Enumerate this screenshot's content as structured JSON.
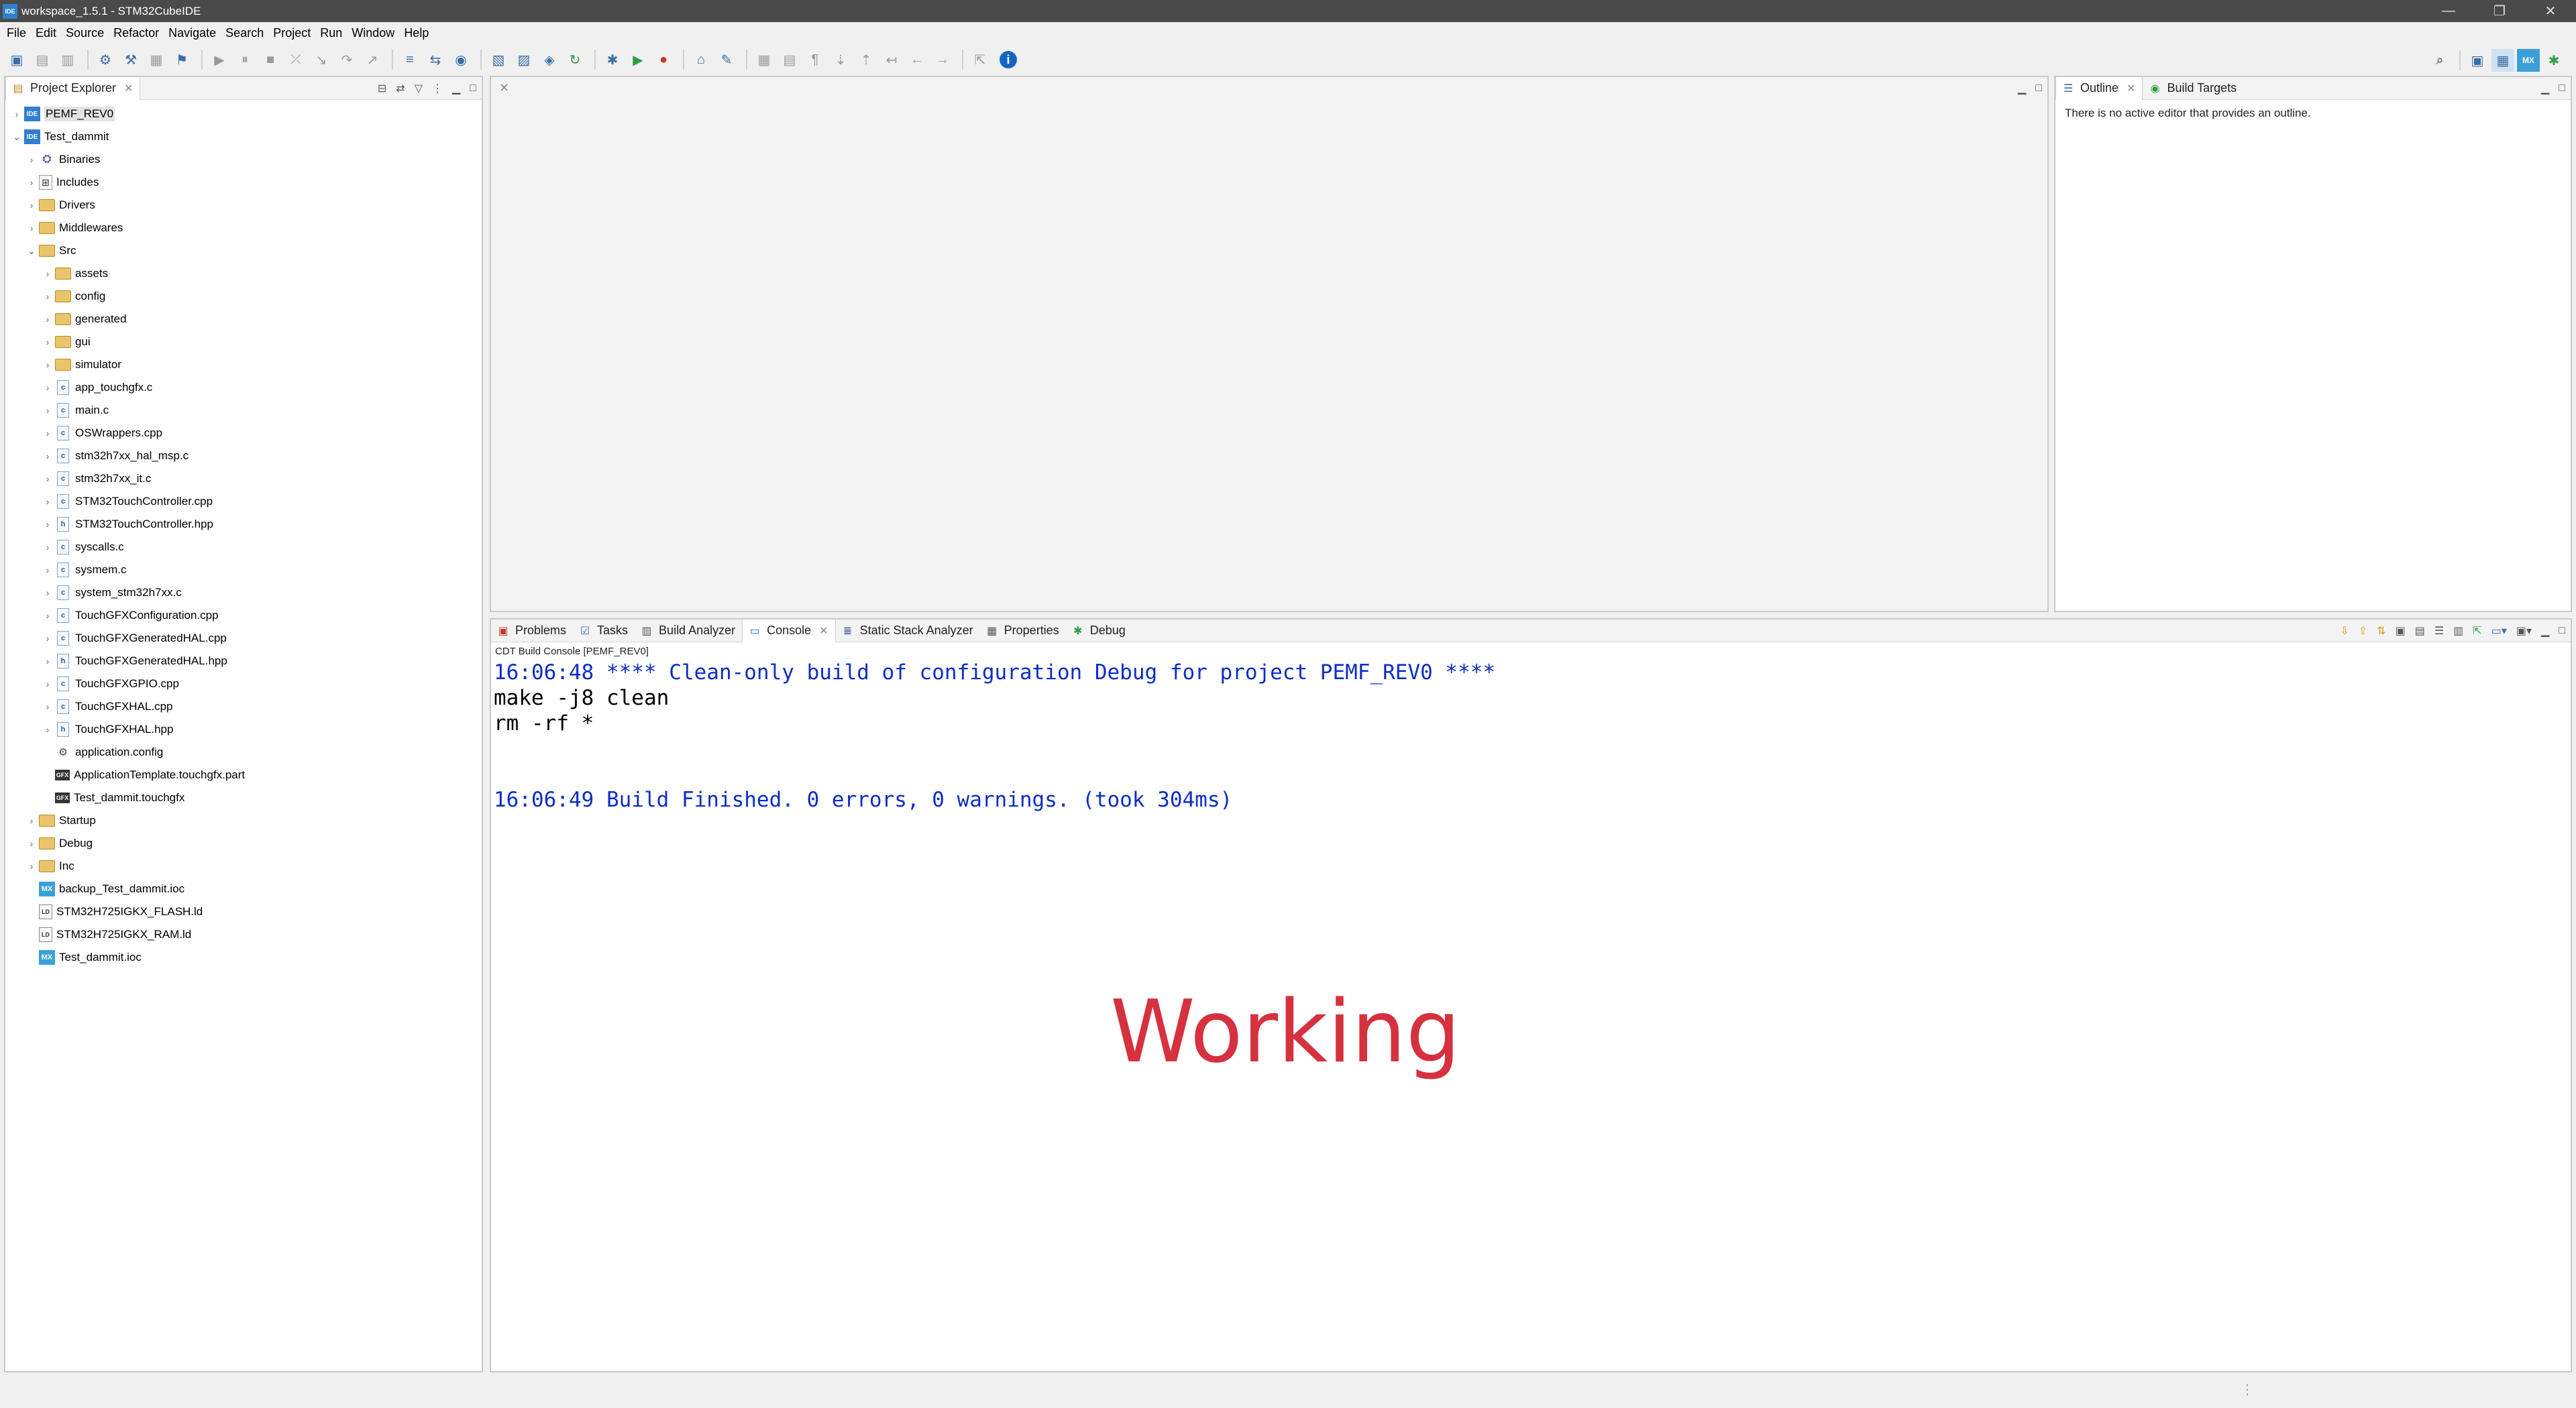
{
  "window": {
    "title": "workspace_1.5.1 - STM32CubeIDE",
    "app_icon": "IDE",
    "controls": [
      "—",
      "❐",
      "✕"
    ]
  },
  "menubar": [
    "File",
    "Edit",
    "Source",
    "Refactor",
    "Navigate",
    "Search",
    "Project",
    "Run",
    "Window",
    "Help"
  ],
  "project_explorer": {
    "tab_label": "Project Explorer",
    "tree": [
      {
        "label": "PEMF_REV0",
        "icon": "project",
        "expand": "collapsed",
        "indent": 0,
        "selected": true
      },
      {
        "label": "Test_dammit",
        "icon": "project",
        "expand": "expanded",
        "indent": 0
      },
      {
        "label": "Binaries",
        "icon": "binaries",
        "expand": "collapsed",
        "indent": 1
      },
      {
        "label": "Includes",
        "icon": "includes",
        "expand": "collapsed",
        "indent": 1
      },
      {
        "label": "Drivers",
        "icon": "folder",
        "expand": "collapsed",
        "indent": 1
      },
      {
        "label": "Middlewares",
        "icon": "folder",
        "expand": "collapsed",
        "indent": 1
      },
      {
        "label": "Src",
        "icon": "folder",
        "expand": "expanded",
        "indent": 1
      },
      {
        "label": "assets",
        "icon": "folder",
        "expand": "collapsed",
        "indent": 2
      },
      {
        "label": "config",
        "icon": "folder",
        "expand": "collapsed",
        "indent": 2
      },
      {
        "label": "generated",
        "icon": "folder",
        "expand": "collapsed",
        "indent": 2
      },
      {
        "label": "gui",
        "icon": "folder",
        "expand": "collapsed",
        "indent": 2
      },
      {
        "label": "simulator",
        "icon": "folder",
        "expand": "collapsed",
        "indent": 2
      },
      {
        "label": "app_touchgfx.c",
        "icon": "c-file",
        "expand": "collapsed",
        "indent": 2
      },
      {
        "label": "main.c",
        "icon": "c-file",
        "expand": "collapsed",
        "indent": 2
      },
      {
        "label": "OSWrappers.cpp",
        "icon": "c-file",
        "expand": "collapsed",
        "indent": 2
      },
      {
        "label": "stm32h7xx_hal_msp.c",
        "icon": "c-file",
        "expand": "collapsed",
        "indent": 2
      },
      {
        "label": "stm32h7xx_it.c",
        "icon": "c-file",
        "expand": "collapsed",
        "indent": 2
      },
      {
        "label": "STM32TouchController.cpp",
        "icon": "c-file",
        "expand": "collapsed",
        "indent": 2
      },
      {
        "label": "STM32TouchController.hpp",
        "icon": "h-file",
        "expand": "collapsed",
        "indent": 2
      },
      {
        "label": "syscalls.c",
        "icon": "c-file",
        "expand": "collapsed",
        "indent": 2
      },
      {
        "label": "sysmem.c",
        "icon": "c-file",
        "expand": "collapsed",
        "indent": 2
      },
      {
        "label": "system_stm32h7xx.c",
        "icon": "c-file",
        "expand": "collapsed",
        "indent": 2
      },
      {
        "label": "TouchGFXConfiguration.cpp",
        "icon": "c-file",
        "expand": "collapsed",
        "indent": 2
      },
      {
        "label": "TouchGFXGeneratedHAL.cpp",
        "icon": "c-file",
        "expand": "collapsed",
        "indent": 2
      },
      {
        "label": "TouchGFXGeneratedHAL.hpp",
        "icon": "h-file",
        "expand": "collapsed",
        "indent": 2
      },
      {
        "label": "TouchGFXGPIO.cpp",
        "icon": "c-file",
        "expand": "collapsed",
        "indent": 2
      },
      {
        "label": "TouchGFXHAL.cpp",
        "icon": "c-file",
        "expand": "collapsed",
        "indent": 2
      },
      {
        "label": "TouchGFXHAL.hpp",
        "icon": "h-file",
        "expand": "collapsed",
        "indent": 2
      },
      {
        "label": "application.config",
        "icon": "gear-file",
        "expand": "none",
        "indent": 2
      },
      {
        "label": "ApplicationTemplate.touchgfx.part",
        "icon": "touchgfx-file",
        "expand": "none",
        "indent": 2
      },
      {
        "label": "Test_dammit.touchgfx",
        "icon": "touchgfx-file",
        "expand": "none",
        "indent": 2
      },
      {
        "label": "Startup",
        "icon": "folder",
        "expand": "collapsed",
        "indent": 1
      },
      {
        "label": "Debug",
        "icon": "folder",
        "expand": "collapsed",
        "indent": 1
      },
      {
        "label": "Inc",
        "icon": "folder",
        "expand": "collapsed",
        "indent": 1
      },
      {
        "label": "backup_Test_dammit.ioc",
        "icon": "mx-file",
        "expand": "none",
        "indent": 1
      },
      {
        "label": "STM32H725IGKX_FLASH.ld",
        "icon": "ld-file",
        "expand": "none",
        "indent": 1
      },
      {
        "label": "STM32H725IGKX_RAM.ld",
        "icon": "ld-file",
        "expand": "none",
        "indent": 1
      },
      {
        "label": "Test_dammit.ioc",
        "icon": "mx-file",
        "expand": "none",
        "indent": 1
      }
    ]
  },
  "outline": {
    "tabs": [
      {
        "label": "Outline",
        "icon": "outline-icon"
      },
      {
        "label": "Build Targets",
        "icon": "build-targets-icon"
      }
    ],
    "message": "There is no active editor that provides an outline."
  },
  "bottom_tabs": [
    {
      "label": "Problems",
      "icon": "problems-icon"
    },
    {
      "label": "Tasks",
      "icon": "tasks-icon"
    },
    {
      "label": "Build Analyzer",
      "icon": "build-analyzer-icon"
    },
    {
      "label": "Console",
      "icon": "console-icon",
      "active": true
    },
    {
      "label": "Static Stack Analyzer",
      "icon": "stack-analyzer-icon"
    },
    {
      "label": "Properties",
      "icon": "properties-icon"
    },
    {
      "label": "Debug",
      "icon": "debug-icon"
    }
  ],
  "console": {
    "title": "CDT Build Console [PEMF_REV0]",
    "lines": [
      {
        "text": "16:06:48 **** Clean-only build of configuration Debug for project PEMF_REV0 ****",
        "color": "blue"
      },
      {
        "text": "make -j8 clean",
        "color": "black"
      },
      {
        "text": "rm -rf *",
        "color": "black"
      },
      {
        "text": "",
        "color": "black"
      },
      {
        "text": "",
        "color": "black"
      },
      {
        "text": "16:06:49 Build Finished. 0 errors, 0 warnings. (took 304ms)",
        "color": "blue"
      }
    ]
  },
  "overlay_text": "Working",
  "colors": {
    "console_blue": "#0c2ec4",
    "overlay_red": "#d6313f",
    "titlebar": "#4a4a4a"
  }
}
